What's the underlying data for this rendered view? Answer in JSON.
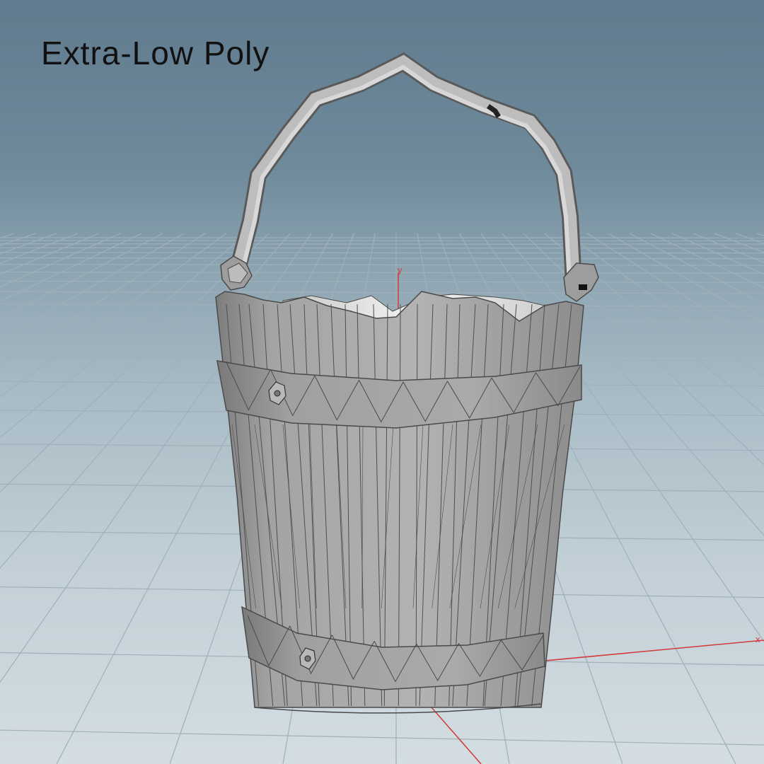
{
  "title": "Extra-Low Poly",
  "axes": {
    "x_label": "x",
    "y_label": "y"
  },
  "colors": {
    "background_top": "#5f7b8d",
    "background_bottom": "#d3dde2",
    "grid": "#9fb0ba",
    "axis": "#d23a3a",
    "model": "#9a9a9a",
    "wire": "#4a4a4a"
  }
}
